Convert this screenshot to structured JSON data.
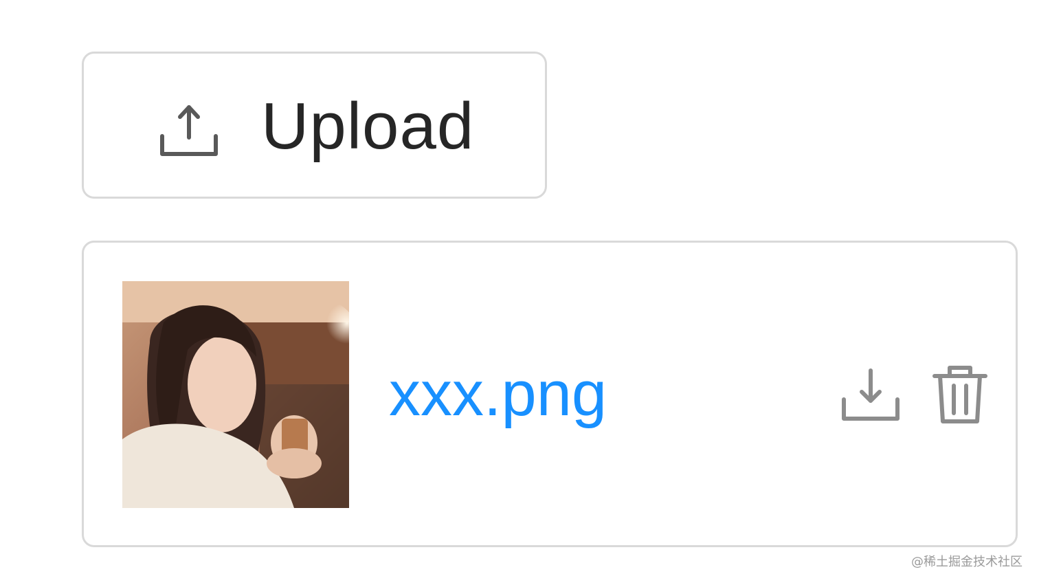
{
  "upload_button": {
    "label": "Upload",
    "icon": "upload-icon"
  },
  "file_item": {
    "name": "xxx.png",
    "thumbnail_icon": "photo-thumbnail",
    "actions": [
      {
        "icon": "download-icon"
      },
      {
        "icon": "trash-icon"
      }
    ]
  },
  "watermark": "@稀土掘金技术社区",
  "colors": {
    "link": "#1890ff",
    "border": "#d9d9d9",
    "icon": "#8c8c8c",
    "text": "#262626"
  }
}
